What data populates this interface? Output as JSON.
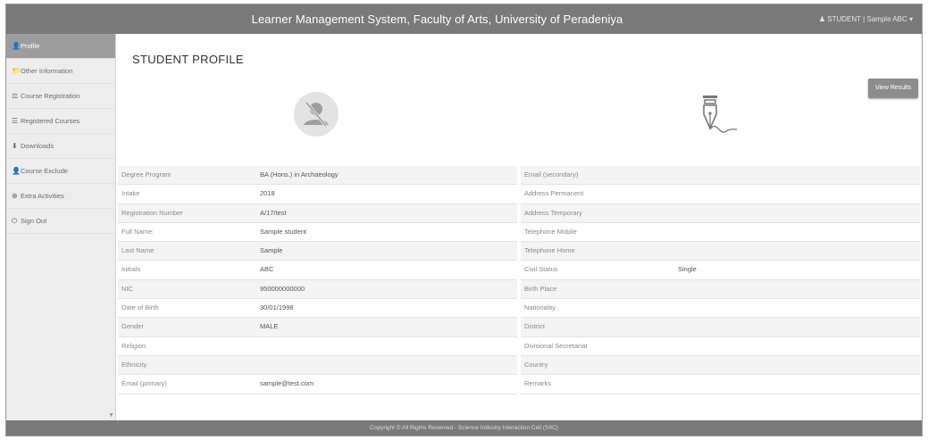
{
  "header": {
    "title": "Learner Management System, Faculty of Arts, University of Peradeniya",
    "user": "♟ STUDENT | Sample ABC ▾"
  },
  "sidebar": {
    "items": [
      {
        "icon": "user-icon",
        "glyph": "👤",
        "label": "Profile",
        "active": true
      },
      {
        "icon": "folder-icon",
        "glyph": "📁",
        "label": "Other Information"
      },
      {
        "icon": "gavel-icon",
        "glyph": "⚖",
        "label": "Course Registration"
      },
      {
        "icon": "list-icon",
        "glyph": "☰",
        "label": "Registered Courses"
      },
      {
        "icon": "download-icon",
        "glyph": "⬇",
        "label": "Downloads"
      },
      {
        "icon": "user-icon",
        "glyph": "👤",
        "label": "Course Exclude"
      },
      {
        "icon": "globe-icon",
        "glyph": "⊕",
        "label": "Extra Activities"
      },
      {
        "icon": "power-icon",
        "glyph": "⏻",
        "label": "Sign Out"
      }
    ]
  },
  "main": {
    "title": "STUDENT PROFILE",
    "view_results": "View Results",
    "left_fields": [
      {
        "label": "Degree Program",
        "value": "BA (Hons.) in Archaeology"
      },
      {
        "label": "Intake",
        "value": "2018"
      },
      {
        "label": "Registration Number",
        "value": "A/17/test"
      },
      {
        "label": "Full Name:",
        "value": "Sample student"
      },
      {
        "label": "Last Name",
        "value": "Sample"
      },
      {
        "label": "Initials",
        "value": "ABC"
      },
      {
        "label": "NIC",
        "value": "950000000000"
      },
      {
        "label": "Date of Birth",
        "value": "30/01/1998"
      },
      {
        "label": "Gender",
        "value": "MALE"
      },
      {
        "label": "Religion",
        "value": ""
      },
      {
        "label": "Ethnicity",
        "value": ""
      },
      {
        "label": "Email (primary)",
        "value": "sample@test.com"
      }
    ],
    "right_fields": [
      {
        "label": "Email (secondary)",
        "value": ""
      },
      {
        "label": "Address Permanent",
        "value": ""
      },
      {
        "label": "Address Temporary",
        "value": ""
      },
      {
        "label": "Telephone Mobile",
        "value": ""
      },
      {
        "label": "Telephone Home",
        "value": ""
      },
      {
        "label": "Civil Status",
        "value": "Single"
      },
      {
        "label": "Birth Place",
        "value": ""
      },
      {
        "label": "Nationality",
        "value": ""
      },
      {
        "label": "District",
        "value": ""
      },
      {
        "label": "Divisional Secretariat",
        "value": ""
      },
      {
        "label": "Country",
        "value": ""
      },
      {
        "label": "Remarks",
        "value": ""
      }
    ]
  },
  "footer": {
    "text": "Copyright © All Rights Reserved - Science Industry Interaction Cell (SIIC)"
  },
  "colors": {
    "topbar": "#7a7a7a",
    "sidebar_bg": "#ededed",
    "sidebar_active": "#9d9d9d",
    "button": "#8c8c8c"
  }
}
